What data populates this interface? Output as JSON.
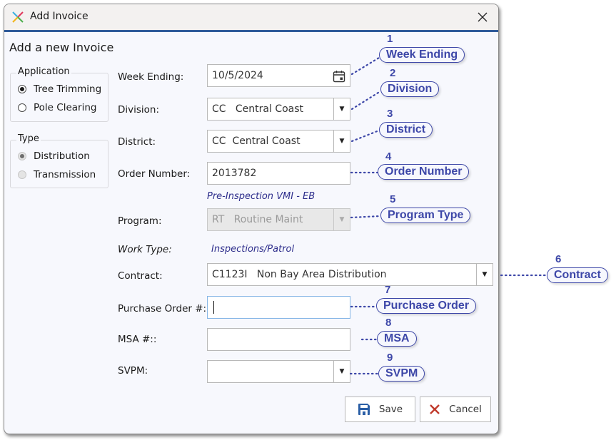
{
  "window": {
    "title": "Add Invoice",
    "close_label": "close"
  },
  "heading": "Add a new Invoice",
  "application_group": {
    "label": "Application",
    "options": [
      {
        "label": "Tree Trimming",
        "selected": true
      },
      {
        "label": "Pole Clearing",
        "selected": false
      }
    ]
  },
  "type_group": {
    "label": "Type",
    "disabled": true,
    "options": [
      {
        "label": "Distribution",
        "selected": true
      },
      {
        "label": "Transmission",
        "selected": false
      }
    ]
  },
  "form": {
    "week_ending": {
      "label": "Week Ending:",
      "value": "10/5/2024",
      "icon": "calendar-icon"
    },
    "division": {
      "label": "Division:",
      "value": "CC   Central Coast"
    },
    "district": {
      "label": "District:",
      "value": "CC  Central Coast"
    },
    "order_number": {
      "label": "Order Number:",
      "value": "2013782"
    },
    "order_info": "Pre-Inspection VMI - EB",
    "program": {
      "label": "Program:",
      "value": "RT   Routine Maint",
      "disabled": true
    },
    "work_type": {
      "label": "Work Type:",
      "value": "Inspections/Patrol"
    },
    "contract": {
      "label": "Contract:",
      "value": "C1123I   Non Bay Area Distribution"
    },
    "purchase_order": {
      "label": "Purchase Order #:",
      "value": ""
    },
    "msa": {
      "label": "MSA #::",
      "value": ""
    },
    "svpm": {
      "label": "SVPM:",
      "value": ""
    }
  },
  "buttons": {
    "save": "Save",
    "cancel": "Cancel"
  },
  "colors": {
    "accent": "#2f5b9a",
    "callout": "#3d47a8",
    "info_text": "#2e2e8c",
    "save_icon": "#2b5fa6",
    "cancel_icon": "#c0392b"
  },
  "callouts": [
    {
      "number": "1",
      "label": "Week Ending"
    },
    {
      "number": "2",
      "label": "Division"
    },
    {
      "number": "3",
      "label": "District"
    },
    {
      "number": "4",
      "label": "Order Number"
    },
    {
      "number": "5",
      "label": "Program Type"
    },
    {
      "number": "6",
      "label": "Contract"
    },
    {
      "number": "7",
      "label": "Purchase Order"
    },
    {
      "number": "8",
      "label": "MSA"
    },
    {
      "number": "9",
      "label": "SVPM"
    }
  ]
}
